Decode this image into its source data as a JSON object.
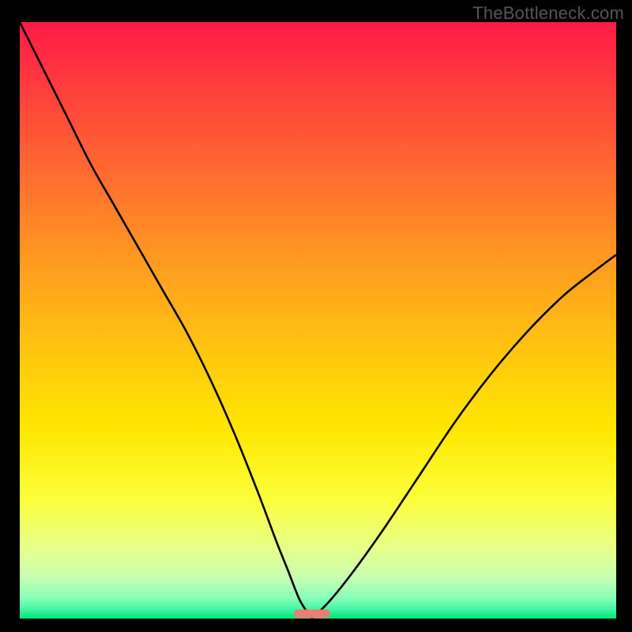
{
  "watermark": "TheBottleneck.com",
  "colors": {
    "black": "#000000",
    "curve": "#000000",
    "marker_fill": "#e77f73",
    "gradient_stops": [
      {
        "offset": 0.0,
        "color": "#ff1a46"
      },
      {
        "offset": 0.1,
        "color": "#ff3a3e"
      },
      {
        "offset": 0.25,
        "color": "#ff6a30"
      },
      {
        "offset": 0.4,
        "color": "#ff9a20"
      },
      {
        "offset": 0.55,
        "color": "#ffc510"
      },
      {
        "offset": 0.68,
        "color": "#ffe600"
      },
      {
        "offset": 0.8,
        "color": "#fbff3a"
      },
      {
        "offset": 0.88,
        "color": "#e8ff88"
      },
      {
        "offset": 0.93,
        "color": "#c8ffb0"
      },
      {
        "offset": 0.965,
        "color": "#8affb8"
      },
      {
        "offset": 0.985,
        "color": "#40f5a4"
      },
      {
        "offset": 1.0,
        "color": "#00e676"
      }
    ]
  },
  "chart_data": {
    "type": "line",
    "title": "",
    "xlabel": "",
    "ylabel": "",
    "xlim": [
      0,
      100
    ],
    "ylim": [
      0,
      100
    ],
    "optimum_x": 49,
    "marker": {
      "x_start": 46,
      "x_end": 52,
      "y": 0.8
    },
    "series": [
      {
        "name": "left-branch",
        "x": [
          0,
          2,
          5,
          8,
          12,
          16,
          20,
          24,
          28,
          32,
          36,
          40,
          43,
          45,
          47,
          49
        ],
        "y": [
          100,
          96,
          90,
          84,
          76,
          69,
          62,
          55,
          48,
          40,
          31,
          21,
          13,
          8,
          3,
          0
        ]
      },
      {
        "name": "right-branch",
        "x": [
          49,
          52,
          56,
          61,
          67,
          73,
          79,
          85,
          91,
          96,
          100
        ],
        "y": [
          0,
          3,
          8,
          15,
          24,
          33,
          41,
          48,
          54,
          58,
          61
        ]
      }
    ]
  }
}
